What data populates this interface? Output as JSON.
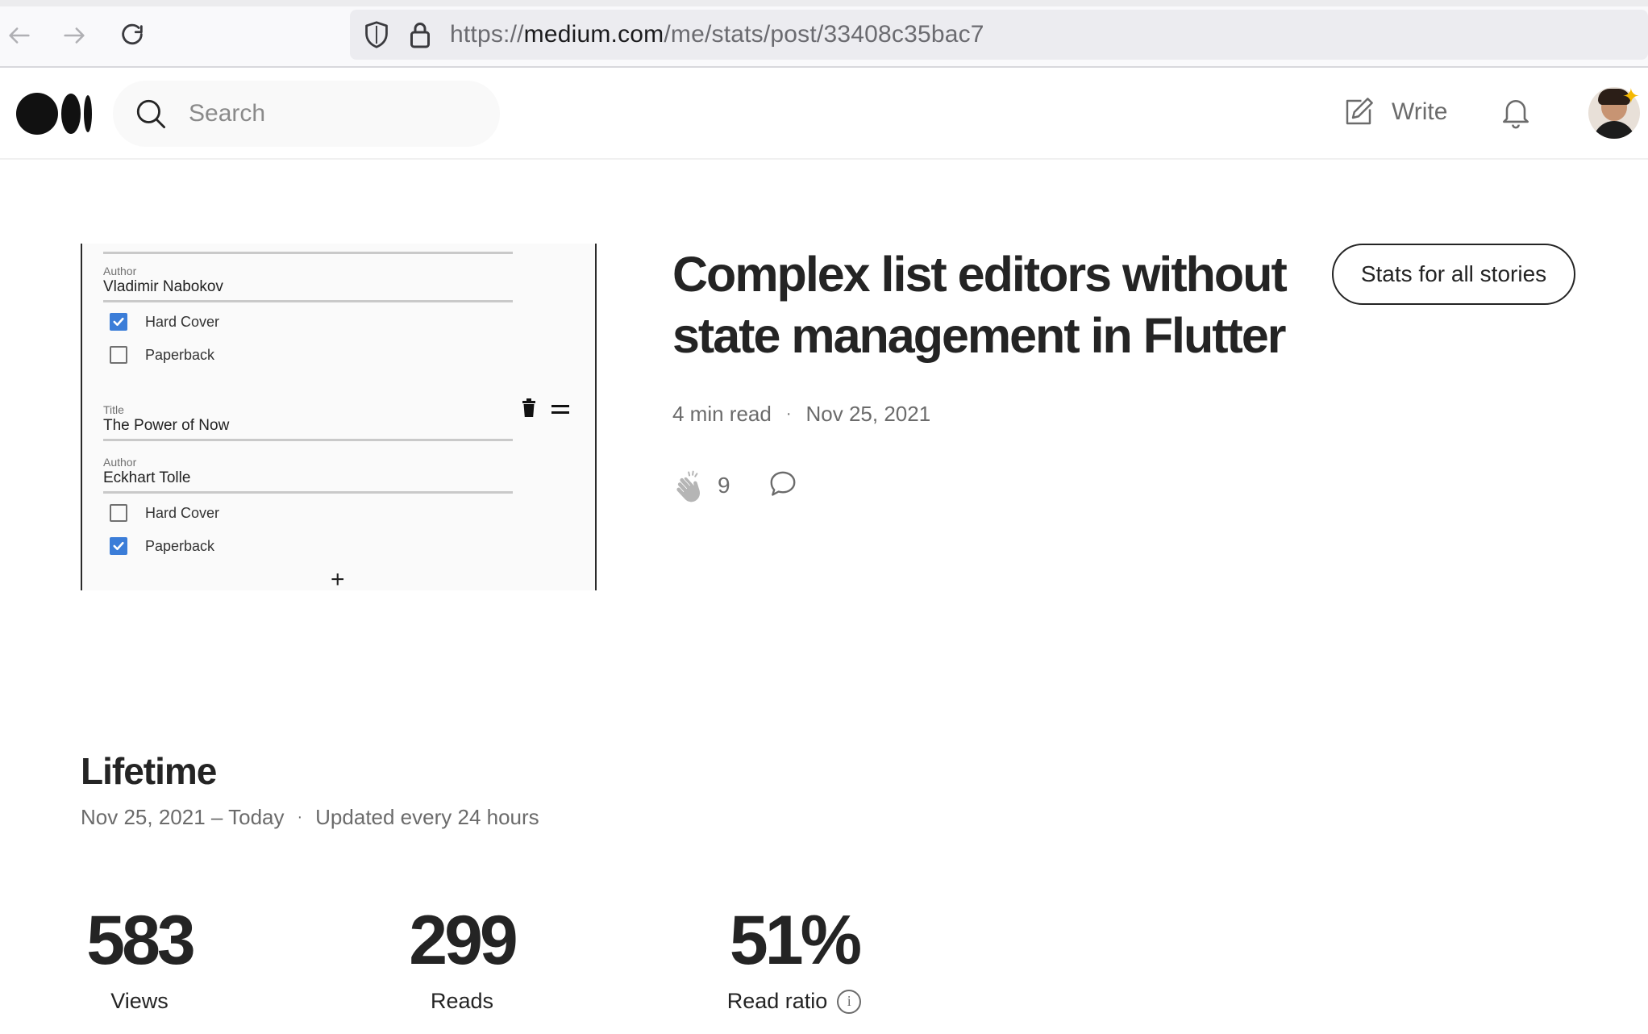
{
  "browser": {
    "url_prefix": "https://",
    "url_domain": "medium.com",
    "url_path": "/me/stats/post/33408c35bac7"
  },
  "header": {
    "search_placeholder": "Search",
    "write_label": "Write"
  },
  "thumbnail": {
    "book1": {
      "author_label": "Author",
      "author_value": "Vladimir Nabokov",
      "options": [
        {
          "label": "Hard Cover",
          "checked": true
        },
        {
          "label": "Paperback",
          "checked": false
        }
      ]
    },
    "book2": {
      "title_label": "Title",
      "title_value": "The Power of Now",
      "author_label": "Author",
      "author_value": "Eckhart Tolle",
      "options": [
        {
          "label": "Hard Cover",
          "checked": false
        },
        {
          "label": "Paperback",
          "checked": true
        }
      ]
    },
    "add_symbol": "+"
  },
  "article": {
    "title": "Complex list editors without state management in Flutter",
    "stats_button": "Stats for all stories",
    "read_time": "4 min read",
    "separator": "·",
    "date": "Nov 25, 2021",
    "claps": "9"
  },
  "lifetime": {
    "title": "Lifetime",
    "range": "Nov 25, 2021 – Today",
    "separator": "·",
    "update_note": "Updated every 24 hours",
    "stats": [
      {
        "value": "583",
        "label": "Views"
      },
      {
        "value": "299",
        "label": "Reads"
      },
      {
        "value": "51%",
        "label": "Read ratio"
      }
    ],
    "info_symbol": "i"
  },
  "colors": {
    "text": "#242424",
    "muted": "#6b6b6b",
    "checkbox_blue": "#3b7dd8"
  }
}
